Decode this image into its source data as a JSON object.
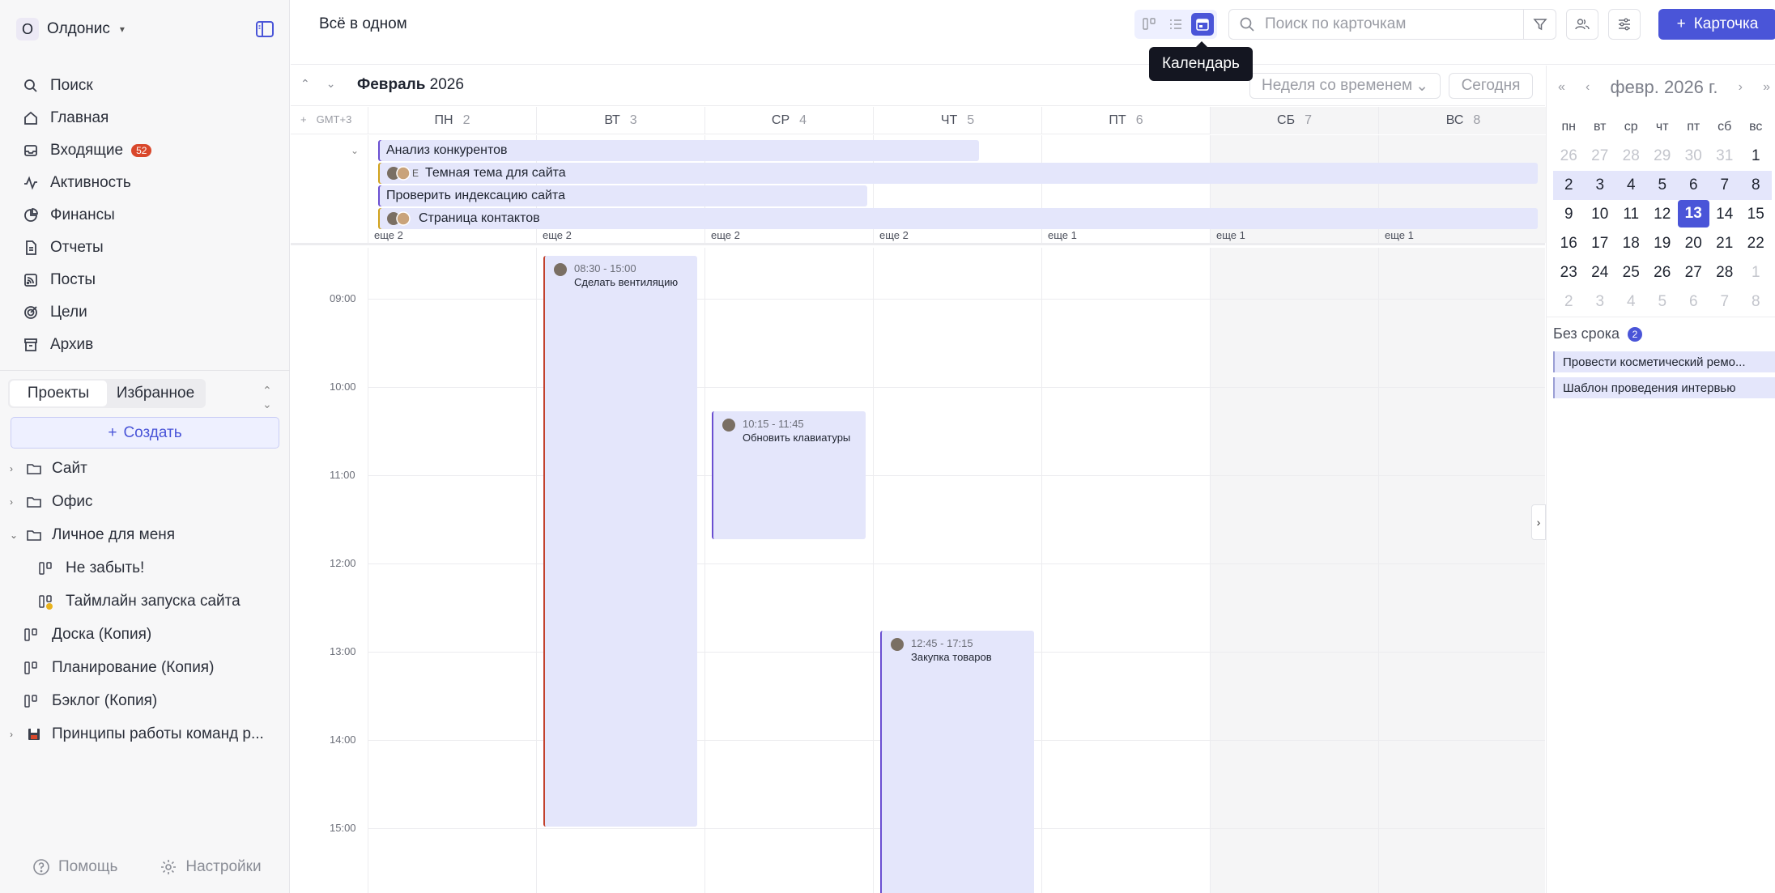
{
  "workspace": {
    "initial": "О",
    "name": "Олдонис"
  },
  "nav": [
    {
      "label": "Поиск",
      "icon": "search-icon"
    },
    {
      "label": "Главная",
      "icon": "home-icon"
    },
    {
      "label": "Входящие",
      "icon": "inbox-icon",
      "badge": "52"
    },
    {
      "label": "Активность",
      "icon": "activity-icon"
    },
    {
      "label": "Финансы",
      "icon": "pie-chart-icon"
    },
    {
      "label": "Отчеты",
      "icon": "report-icon"
    },
    {
      "label": "Посты",
      "icon": "rss-icon"
    },
    {
      "label": "Цели",
      "icon": "target-icon"
    },
    {
      "label": "Архив",
      "icon": "archive-icon"
    }
  ],
  "sidebar_tabs": {
    "projects": "Проекты",
    "favorites": "Избранное"
  },
  "create_label": "Создать",
  "tree": [
    {
      "label": "Сайт",
      "type": "folder"
    },
    {
      "label": "Офис",
      "type": "folder"
    },
    {
      "label": "Личное для меня",
      "type": "folder-open"
    },
    {
      "label": "Не забыть!",
      "type": "board"
    },
    {
      "label": "Таймлайн запуска сайта",
      "type": "board-star"
    },
    {
      "label": "Доска (Копия)",
      "type": "board"
    },
    {
      "label": "Планирование (Копия)",
      "type": "board"
    },
    {
      "label": "Бэклог (Копия)",
      "type": "board"
    },
    {
      "label": "Принципы работы команд р...",
      "type": "doc"
    }
  ],
  "sidebar_bottom": {
    "help": "Помощь",
    "settings": "Настройки"
  },
  "header": {
    "title": "Всё в одном",
    "tooltip": "Календарь",
    "search_placeholder": "Поиск по карточкам",
    "card_button": "Карточка"
  },
  "calendar": {
    "month": "Февраль",
    "year": "2026",
    "mode": "Неделя со временем",
    "today_label": "Сегодня",
    "timezone": "GMT+3",
    "days": [
      {
        "wd": "ПН",
        "d": "2",
        "more": "еще 2"
      },
      {
        "wd": "ВТ",
        "d": "3",
        "more": "еще 2"
      },
      {
        "wd": "СР",
        "d": "4",
        "more": "еще 2"
      },
      {
        "wd": "ЧТ",
        "d": "5",
        "more": "еще 2"
      },
      {
        "wd": "ПТ",
        "d": "6",
        "more": "еще 1"
      },
      {
        "wd": "СБ",
        "d": "7",
        "more": "еще 1"
      },
      {
        "wd": "ВС",
        "d": "8",
        "more": "еще 1"
      }
    ],
    "allday_events": [
      {
        "name": "Анализ конкурентов",
        "avatars": false,
        "extra": ""
      },
      {
        "name": "Темная тема для сайта",
        "avatars": true,
        "extra": "Е"
      },
      {
        "name": "Проверить индексацию сайта",
        "avatars": false,
        "extra": ""
      },
      {
        "name": "Страница контактов",
        "avatars": true,
        "extra": ""
      }
    ],
    "hours": [
      "09:00",
      "10:00",
      "11:00",
      "12:00",
      "13:00",
      "14:00",
      "15:00"
    ],
    "events": [
      {
        "time": "08:30 - 15:00",
        "name": "Сделать вентиляцию",
        "accent": "#c2412d"
      },
      {
        "time": "10:15 - 11:45",
        "name": "Обновить клавиатуры",
        "accent": "#6a4fd1"
      },
      {
        "time": "12:45 - 17:15",
        "name": "Закупка товаров",
        "accent": "#6a4fd1"
      }
    ]
  },
  "mini_calendar": {
    "title": "февр. 2026 г.",
    "weekdays": [
      "пн",
      "вт",
      "ср",
      "чт",
      "пт",
      "сб",
      "вс"
    ],
    "weeks": [
      [
        "26",
        "27",
        "28",
        "29",
        "30",
        "31",
        "1"
      ],
      [
        "2",
        "3",
        "4",
        "5",
        "6",
        "7",
        "8"
      ],
      [
        "9",
        "10",
        "11",
        "12",
        "13",
        "14",
        "15"
      ],
      [
        "16",
        "17",
        "18",
        "19",
        "20",
        "21",
        "22"
      ],
      [
        "23",
        "24",
        "25",
        "26",
        "27",
        "28",
        "1"
      ],
      [
        "2",
        "3",
        "4",
        "5",
        "6",
        "7",
        "8"
      ]
    ],
    "today": "13"
  },
  "no_deadline": {
    "title": "Без срока",
    "count": "2",
    "items": [
      "Провести косметический ремо...",
      "Шаблон проведения интервью"
    ]
  },
  "colors": {
    "accent": "#4a55d8",
    "event_bg": "#e4e6fb",
    "badge": "#d9472b"
  }
}
